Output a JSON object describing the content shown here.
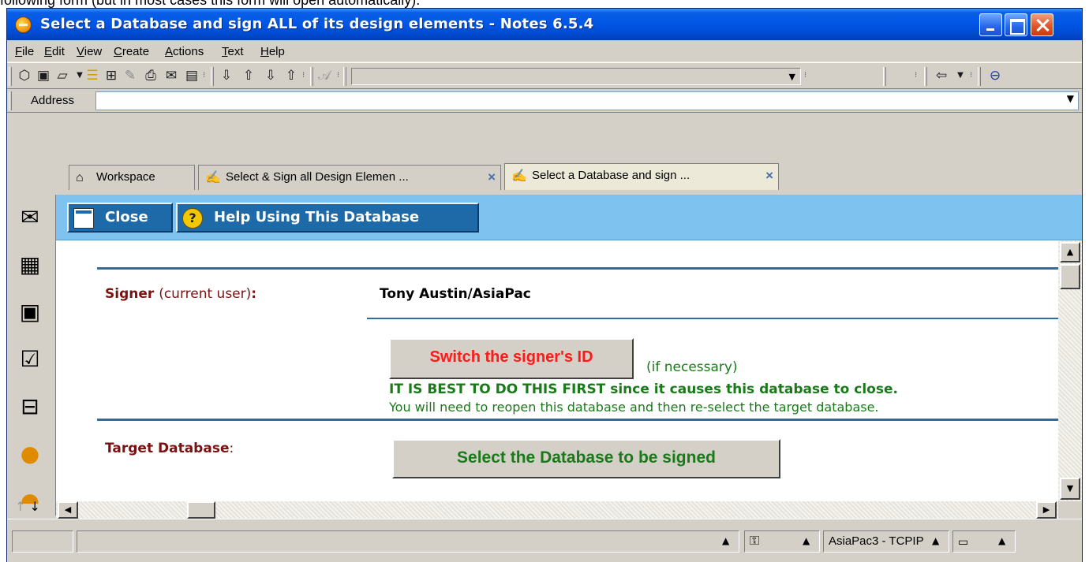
{
  "caption_fragment": "following form (but in most cases this form will open automatically).",
  "window": {
    "title": "Select a Database and sign ALL of its design elements - Notes 6.5.4"
  },
  "menu": [
    "File",
    "Edit",
    "View",
    "Create",
    "Actions",
    "Text",
    "Help"
  ],
  "address": {
    "label": "Address",
    "value": ""
  },
  "tabs": [
    {
      "label": "Workspace",
      "icon": "workspace-icon",
      "closable": false
    },
    {
      "label": "Select & Sign all Design Elemen ...",
      "icon": "sign-document-icon",
      "closable": true
    },
    {
      "label": "Select a Database and sign ...",
      "icon": "sign-database-icon",
      "closable": true,
      "active": true
    }
  ],
  "actions": {
    "close_label": "Close",
    "help_label": "Help Using This Database"
  },
  "form": {
    "signer_label": "Signer",
    "signer_sub": "(current user)",
    "signer_colon": ":",
    "signer_value": "Tony Austin/AsiaPac",
    "switch_button": "Switch the signer's ID",
    "if_necessary": "(if necessary)",
    "warning": "IT IS BEST TO DO THIS FIRST since it causes this database to close.",
    "note": "You will need to reopen this database and then re-select the target database.",
    "target_label": "Target Database",
    "target_colon": ":",
    "select_button": "Select the Database to be signed"
  },
  "status": {
    "location": "AsiaPac3 - TCPIP"
  },
  "colors": {
    "titlebar": "#0055e5",
    "actionbar": "#7ec3ef",
    "label_red": "#7a1212",
    "green_text": "#1a7a1a",
    "switch_red": "#ff1a1a",
    "rule_blue": "#2e6da4"
  }
}
